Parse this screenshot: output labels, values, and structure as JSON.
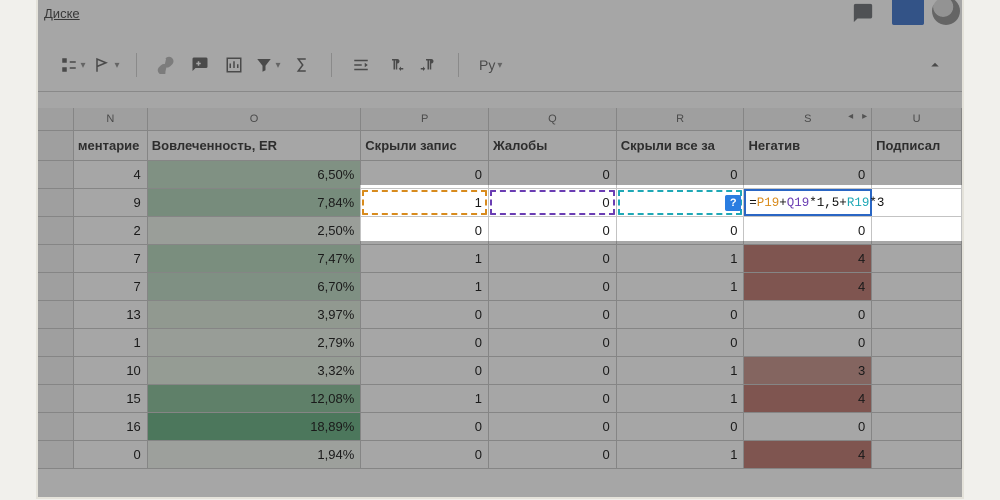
{
  "top": {
    "disk_link": "Диске",
    "blue_button": "",
    "avatar": true
  },
  "toolbar": {
    "pytxt": "Py"
  },
  "columns": [
    {
      "letter": "N",
      "label": "ментарие",
      "w": "w-n"
    },
    {
      "letter": "O",
      "label": "Вовлеченность, ER",
      "w": "w-o"
    },
    {
      "letter": "P",
      "label": "Скрыли запис",
      "w": "w-p"
    },
    {
      "letter": "Q",
      "label": "Жалобы",
      "w": "w-q"
    },
    {
      "letter": "R",
      "label": "Скрыли все за",
      "w": "w-r"
    },
    {
      "letter": "S",
      "label": "Негатив",
      "nav": true,
      "w": "w-s"
    },
    {
      "letter": "U",
      "label": "Подписал",
      "w": "w-u"
    }
  ],
  "active_formula": {
    "prefix": "=",
    "parts": [
      {
        "t": "P19",
        "c": "fc-orange"
      },
      {
        "t": "+",
        "c": "fc-plain"
      },
      {
        "t": "Q19",
        "c": "fc-purple"
      },
      {
        "t": "*1,5+",
        "c": "fc-plain"
      },
      {
        "t": "R19",
        "c": "fc-teal"
      },
      {
        "t": "*3",
        "c": "fc-plain"
      }
    ]
  },
  "rows": [
    {
      "n": "4",
      "o": "6,50%",
      "oc": "#b9d8bf",
      "p": "0",
      "q": "0",
      "r": "0",
      "s": "0",
      "sc": ""
    },
    {
      "n": "9",
      "o": "7,84%",
      "oc": "#a9d0b2",
      "p": "1",
      "pref": "orange",
      "q": "0",
      "qref": "purple",
      "r": "",
      "rref": "teal",
      "rhint": "?",
      "s": "__FORMULA__",
      "sc": ""
    },
    {
      "n": "2",
      "o": "2,50%",
      "oc": "#e9f1e7",
      "p": "0",
      "q": "0",
      "r": "0",
      "s": "0",
      "sc": ""
    },
    {
      "n": "7",
      "o": "7,47%",
      "oc": "#aed3b6",
      "p": "1",
      "q": "0",
      "r": "1",
      "s": "4",
      "sc": "#b86a60"
    },
    {
      "n": "7",
      "o": "6,70%",
      "oc": "#b7d7be",
      "p": "1",
      "q": "0",
      "r": "1",
      "s": "4",
      "sc": "#b86a60"
    },
    {
      "n": "13",
      "o": "3,97%",
      "oc": "#d8e8d7",
      "p": "0",
      "q": "0",
      "r": "0",
      "s": "0",
      "sc": ""
    },
    {
      "n": "1",
      "o": "2,79%",
      "oc": "#e6efe4",
      "p": "0",
      "q": "0",
      "r": "0",
      "s": "0",
      "sc": ""
    },
    {
      "n": "10",
      "o": "3,32%",
      "oc": "#dfecde",
      "p": "0",
      "q": "0",
      "r": "1",
      "s": "3",
      "sc": "#c0887f"
    },
    {
      "n": "15",
      "o": "12,08%",
      "oc": "#7cba8f",
      "p": "1",
      "q": "0",
      "r": "1",
      "s": "4",
      "sc": "#b86a60"
    },
    {
      "n": "16",
      "o": "18,89%",
      "oc": "#5aa877",
      "p": "0",
      "q": "0",
      "r": "0",
      "s": "0",
      "sc": ""
    },
    {
      "n": "0",
      "o": "1,94%",
      "oc": "#eef4ec",
      "p": "0",
      "q": "0",
      "r": "1",
      "s": "4",
      "sc": "#b86a60"
    }
  ]
}
